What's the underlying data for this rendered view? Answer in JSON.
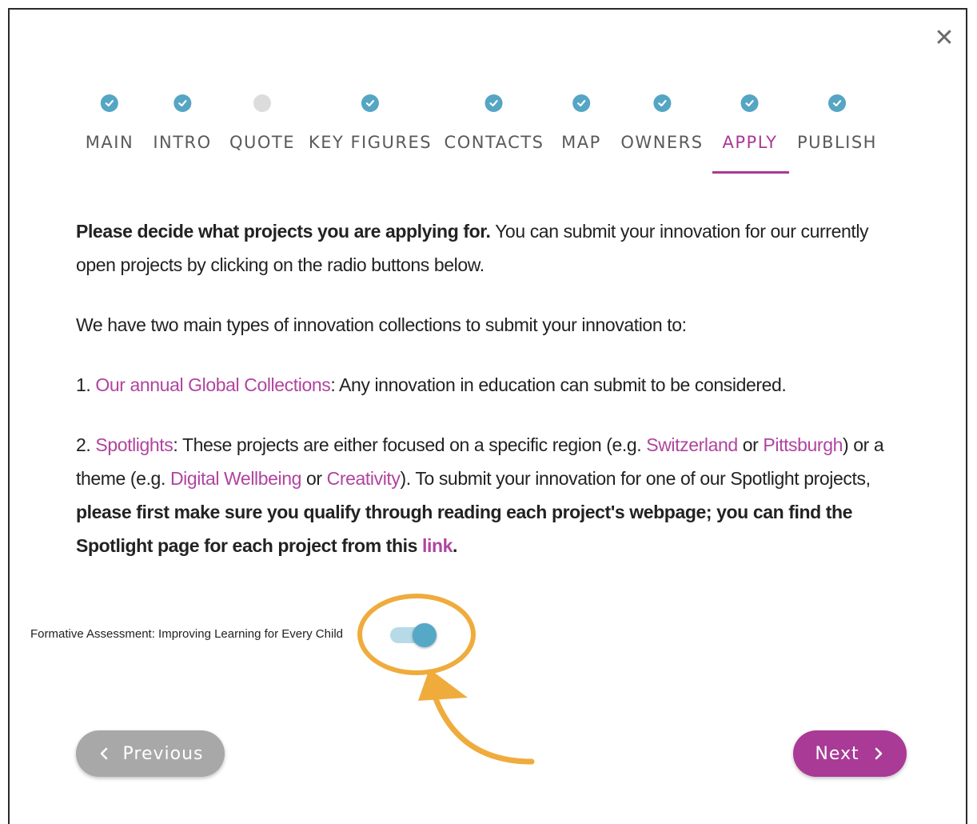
{
  "modal": {
    "close_glyph": "✕"
  },
  "steps": [
    {
      "label": "MAIN",
      "status": "done"
    },
    {
      "label": "INTRO",
      "status": "done"
    },
    {
      "label": "QUOTE",
      "status": "incomplete"
    },
    {
      "label": "KEY FIGURES",
      "status": "done"
    },
    {
      "label": "CONTACTS",
      "status": "done"
    },
    {
      "label": "MAP",
      "status": "done"
    },
    {
      "label": "OWNERS",
      "status": "done"
    },
    {
      "label": "APPLY",
      "status": "done",
      "active": true
    },
    {
      "label": "PUBLISH",
      "status": "done"
    }
  ],
  "content": {
    "p1_bold": "Please decide what projects you are applying for.",
    "p1_text": " You can submit your innovation for our currently open projects by clicking on the radio buttons below.",
    "p2_text": "We have two main types of innovation collections to submit your innovation to:",
    "p3_num": "1. ",
    "p3_link": "Our annual Global Collections",
    "p3_text": ": Any innovation in education can submit to be considered.",
    "p4_num": "2. ",
    "p4_link_spotlights": "Spotlights",
    "p4_text_a": ": These projects are either focused on a specific region (e.g. ",
    "p4_link_switzerland": "Switzerland",
    "p4_text_or1": " or ",
    "p4_link_pittsburgh": "Pittsburgh",
    "p4_text_b": ") or a theme (e.g. ",
    "p4_link_wellbeing": "Digital Wellbeing",
    "p4_text_or2": " or ",
    "p4_link_creativity": "Creativity",
    "p4_text_c": "). To submit your innovation for one of our Spotlight projects, ",
    "p4_bold": "please first make sure you qualify through reading each project's webpage; you can find the Spotlight page for each project from this ",
    "p4_bold_link": "link",
    "p4_bold_end": "."
  },
  "toggle": {
    "label": "Formative Assessment: Improving Learning for Every Child",
    "checked": true
  },
  "colors": {
    "accent": "#a93a96",
    "step_done": "#55a5c4",
    "highlight": "#efac3c"
  },
  "nav": {
    "previous_label": "Previous",
    "next_label": "Next"
  }
}
